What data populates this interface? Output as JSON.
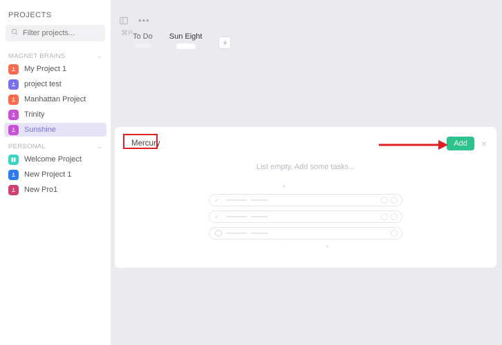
{
  "sidebar": {
    "title": "PROJECTS",
    "filter_placeholder": "Filter projects...",
    "shortcut": "⌘P",
    "sections": [
      {
        "label": "MAGNET BRAINS",
        "items": [
          {
            "label": "My Project 1",
            "color": "#ff6a4d"
          },
          {
            "label": "project test",
            "color": "#7a6ff0"
          },
          {
            "label": "Manhattan Project",
            "color": "#ff6a4d"
          },
          {
            "label": "Trinity",
            "color": "#c94fd8"
          },
          {
            "label": "Sunshine",
            "color": "#c94fd8",
            "selected": true
          }
        ]
      },
      {
        "label": "PERSONAL",
        "items": [
          {
            "label": "Welcome Project",
            "color": "#38d6c4"
          },
          {
            "label": "New Project 1",
            "color": "#2a7bf5"
          },
          {
            "label": "New Pro1",
            "color": "#d23e6e"
          }
        ]
      }
    ]
  },
  "tabs": [
    {
      "label": "To Do",
      "active": false
    },
    {
      "label": "Sun Eight",
      "active": true
    }
  ],
  "panel": {
    "title": "Mercury",
    "add_label": "Add",
    "empty_message": "List empty. Add some tasks..."
  },
  "colors": {
    "accent_green": "#2bc28c",
    "highlight_red": "#e02020"
  }
}
